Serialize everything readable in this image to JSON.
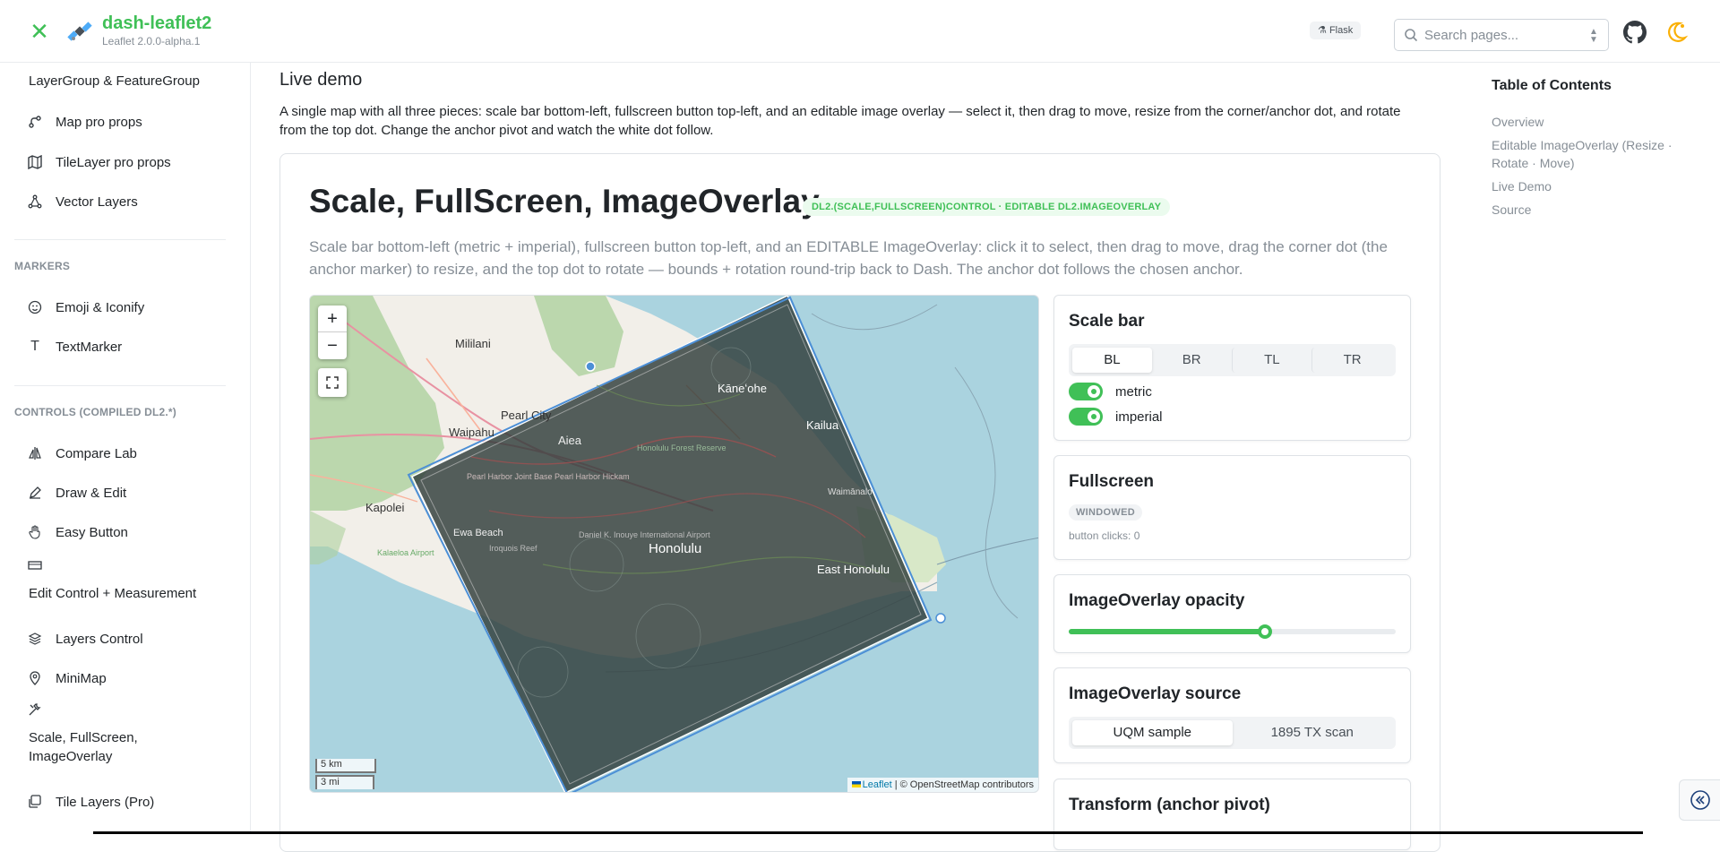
{
  "header": {
    "app_title": "dash-leaflet2",
    "app_subtitle": "Leaflet 2.0.0-alpha.1",
    "framework_badge": "Flask",
    "search_placeholder": "Search pages..."
  },
  "sidebar": {
    "items_top": [
      {
        "label": "LayerGroup & FeatureGroup",
        "icon": "layers-icon"
      },
      {
        "label": "Map pro props",
        "icon": "route-icon"
      },
      {
        "label": "TileLayer pro props",
        "icon": "map-icon"
      },
      {
        "label": "Vector Layers",
        "icon": "vector-icon"
      }
    ],
    "section_markers": "MARKERS",
    "items_markers": [
      {
        "label": "Emoji & Iconify",
        "icon": "emoji-icon"
      },
      {
        "label": "TextMarker",
        "icon": "text-icon"
      }
    ],
    "section_controls": "CONTROLS (COMPILED DL2.*)",
    "items_controls": [
      {
        "label": "Compare Lab",
        "icon": "compare-icon"
      },
      {
        "label": "Draw & Edit",
        "icon": "pencil-icon"
      },
      {
        "label": "Easy Button",
        "icon": "hand-icon"
      },
      {
        "label": "Edit Control + Measurement",
        "icon": "ruler-icon"
      },
      {
        "label": "Layers Control",
        "icon": "stack-icon"
      },
      {
        "label": "MiniMap",
        "icon": "pin-icon"
      },
      {
        "label": "Scale, FullScreen, ImageOverlay",
        "icon": "tools-icon"
      },
      {
        "label": "Tile Layers (Pro)",
        "icon": "tiles-icon"
      }
    ]
  },
  "main": {
    "section_title": "Live demo",
    "section_desc": "A single map with all three pieces: scale bar bottom-left, fullscreen button top-left, and an editable image overlay — select it, then drag to move, resize from the corner/anchor dot, and rotate from the top dot. Change the anchor pivot and watch the white dot follow.",
    "demo_title": "Scale, FullScreen, ImageOverlay",
    "demo_badge": "DL2.(SCALE,FULLSCREEN)CONTROL · EDITABLE DL2.IMAGEOVERLAY",
    "demo_desc": "Scale bar bottom-left (metric + imperial), fullscreen button top-left, and an EDITABLE ImageOverlay: click it to select, then drag to move, drag the corner dot (the anchor marker) to resize, and the top dot to rotate — bounds + rotation round-trip back to Dash. The anchor dot follows the chosen anchor."
  },
  "map": {
    "zoom_in": "+",
    "zoom_out": "−",
    "scale_metric": "5 km",
    "scale_imperial": "3 mi",
    "attribution_leaflet": "Leaflet",
    "attribution_osm": " | © OpenStreetMap contributors",
    "place_labels": {
      "mililani": "Mililani",
      "kaneohe": "Kāneʻohe",
      "pearl_city": "Pearl City",
      "waipahu": "Waipahu",
      "aiea": "Aiea",
      "kailua": "Kailua",
      "waimanalo": "Waimānalo",
      "kapolei": "Kapolei",
      "ewa_beach": "Ewa Beach",
      "honolulu": "Honolulu",
      "east_honolulu": "East Honolulu",
      "pearl_harbor": "Pearl Harbor Joint Base Pearl Harbor Hickam",
      "forest_reserve": "Honolulu Forest Reserve",
      "kalaeloa": "Kalaeloa Airport",
      "daniel_k": "Daniel K. Inouye International Airport",
      "iroquois": "Iroquois Reef"
    }
  },
  "panels": {
    "scale": {
      "title": "Scale bar",
      "positions": [
        "BL",
        "BR",
        "TL",
        "TR"
      ],
      "active_position": "BL",
      "metric_label": "metric",
      "imperial_label": "imperial",
      "metric_on": true,
      "imperial_on": true
    },
    "fullscreen": {
      "title": "Fullscreen",
      "state": "WINDOWED",
      "clicks": "button clicks: 0"
    },
    "opacity": {
      "title": "ImageOverlay opacity",
      "value": 0.6
    },
    "source": {
      "title": "ImageOverlay source",
      "options": [
        "UQM sample",
        "1895 TX scan"
      ],
      "active": "UQM sample"
    },
    "transform": {
      "title": "Transform (anchor pivot)"
    }
  },
  "toc": {
    "title": "Table of Contents",
    "items": [
      "Overview",
      "Editable ImageOverlay (Resize · Rotate · Move)",
      "Live Demo",
      "Source"
    ]
  },
  "colors": {
    "accent": "#40c057",
    "water": "#aad3df",
    "overlay": "#2f3d3a"
  }
}
